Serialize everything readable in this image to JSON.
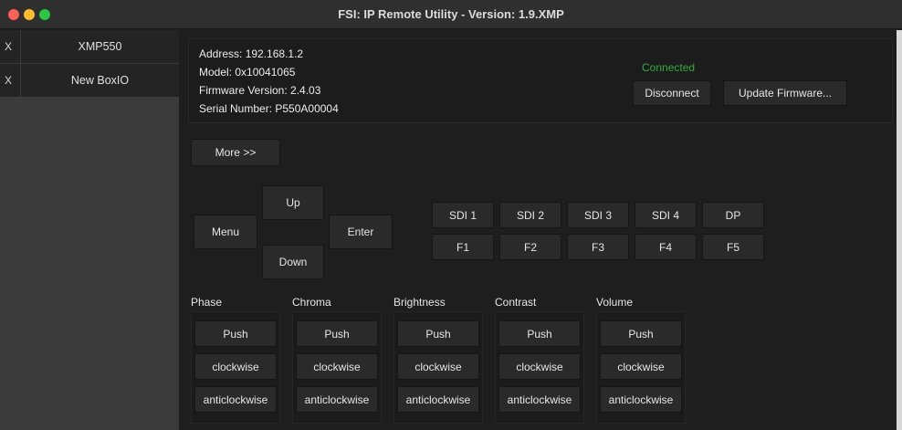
{
  "window": {
    "title": "FSI: IP Remote Utility - Version: 1.9.XMP"
  },
  "sidebar": {
    "items": [
      {
        "close": "X",
        "name": "XMP550"
      },
      {
        "close": "X",
        "name": "New BoxIO"
      }
    ]
  },
  "device_info": {
    "address": "Address: 192.168.1.2",
    "model": "Model: 0x10041065",
    "firmware": "Firmware Version: 2.4.03",
    "serial": "Serial Number: P550A00004",
    "status": "Connected",
    "disconnect_label": "Disconnect",
    "update_firmware_label": "Update Firmware..."
  },
  "more_label": "More >>",
  "dpad": {
    "up": "Up",
    "menu": "Menu",
    "enter": "Enter",
    "down": "Down"
  },
  "inputs": [
    "SDI 1",
    "SDI 2",
    "SDI 3",
    "SDI 4",
    "DP"
  ],
  "functions": [
    "F1",
    "F2",
    "F3",
    "F4",
    "F5"
  ],
  "knobs": [
    {
      "label": "Phase",
      "push": "Push",
      "cw": "clockwise",
      "ccw": "anticlockwise"
    },
    {
      "label": "Chroma",
      "push": "Push",
      "cw": "clockwise",
      "ccw": "anticlockwise"
    },
    {
      "label": "Brightness",
      "push": "Push",
      "cw": "clockwise",
      "ccw": "anticlockwise"
    },
    {
      "label": "Contrast",
      "push": "Push",
      "cw": "clockwise",
      "ccw": "anticlockwise"
    },
    {
      "label": "Volume",
      "push": "Push",
      "cw": "clockwise",
      "ccw": "anticlockwise"
    }
  ],
  "colors": {
    "connected": "#2fae3a",
    "background": "#1e1e1e",
    "sidebar": "#3b3b3b"
  }
}
